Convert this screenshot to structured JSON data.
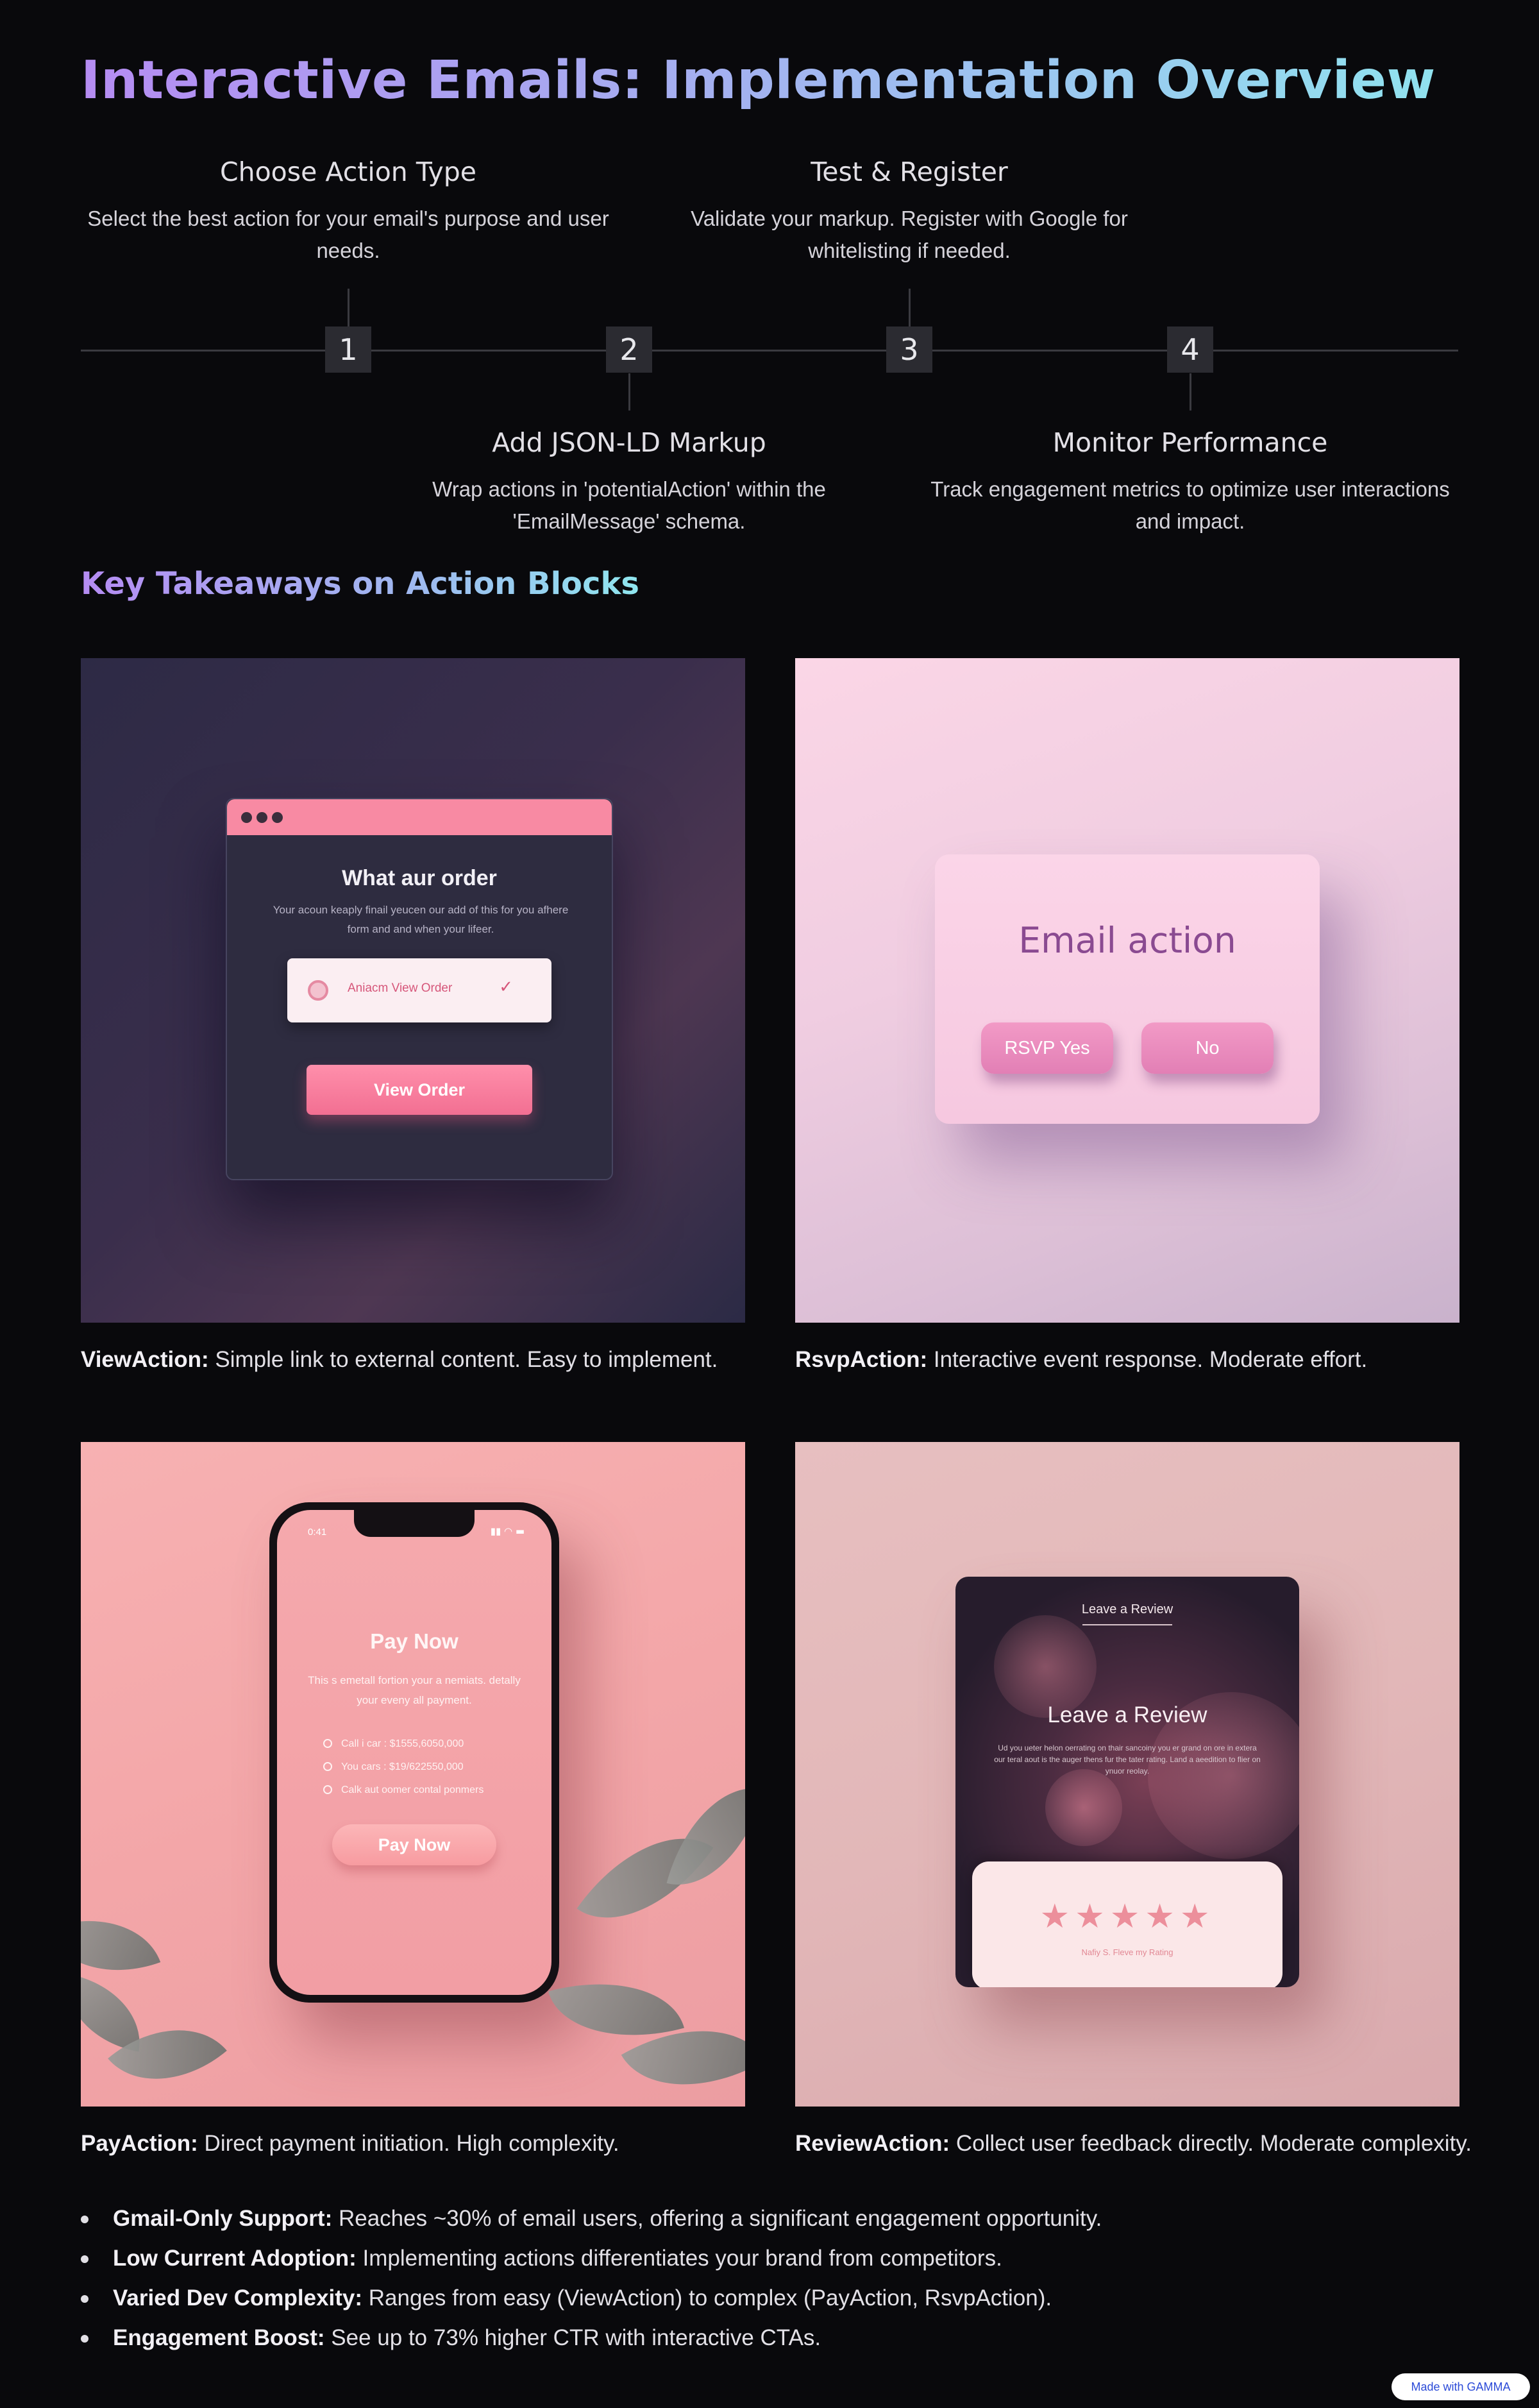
{
  "page": {
    "title": "Interactive Emails: Implementation Overview",
    "subtitle": "Key Takeaways on Action Blocks",
    "badge": "Made with GAMMA"
  },
  "timeline": [
    {
      "number": "1",
      "title": "Choose Action Type",
      "description": "Select the best action for your email's purpose and user needs."
    },
    {
      "number": "2",
      "title": "Add JSON-LD Markup",
      "description": "Wrap actions in 'potentialAction' within the 'EmailMessage' schema."
    },
    {
      "number": "3",
      "title": "Test & Register",
      "description": "Validate your markup. Register with Google for whitelisting if needed."
    },
    {
      "number": "4",
      "title": "Monitor Performance",
      "description": "Track engagement metrics to optimize user interactions and impact."
    }
  ],
  "cards": [
    {
      "label": "ViewAction:",
      "text": " Simple link to external content. Easy to implement.",
      "illustration": {
        "title": "What aur order",
        "body": "Your acoun keaply finail yeucen our add of this for you afhere form and and when your lifeer.",
        "item_label": "Aniacm View Order",
        "button": "View Order"
      }
    },
    {
      "label": "RsvpAction:",
      "text": " Interactive event response. Moderate effort.",
      "illustration": {
        "title": "Email action",
        "yes_button": "RSVP Yes",
        "no_button": "No"
      }
    },
    {
      "label": "PayAction:",
      "text": " Direct payment initiation. High complexity.",
      "illustration": {
        "time": "0:41",
        "title": "Pay Now",
        "body": "This s emetall fortion your a nemiats. detally your eveny all payment.",
        "rows": [
          "Call i car : $1555,6050,000",
          "You cars : $19/622550,000",
          "Calk aut oomer contal ponmers"
        ],
        "button": "Pay Now"
      }
    },
    {
      "label": "ReviewAction:",
      "text": " Collect user feedback directly. Moderate complexity.",
      "illustration": {
        "header": "Leave a Review",
        "title": "Leave a Review",
        "body": "Ud you ueter helon oerrating on thair sancoiny you er grand on ore in extera our teral aout is the auger thens fur the tater rating. Land a aeedition to flier on ynuor reolay.",
        "stars": "★★★★★",
        "caption": "Nafiy S. Fleve my Rating"
      }
    }
  ],
  "bullets": [
    {
      "label": "Gmail-Only Support:",
      "text": " Reaches ~30% of email users, offering a significant engagement opportunity."
    },
    {
      "label": "Low Current Adoption:",
      "text": " Implementing actions differentiates your brand from competitors."
    },
    {
      "label": "Varied Dev Complexity:",
      "text": " Ranges from easy (ViewAction) to complex (PayAction, RsvpAction)."
    },
    {
      "label": "Engagement Boost:",
      "text": " See up to 73% higher CTR with interactive CTAs."
    }
  ]
}
